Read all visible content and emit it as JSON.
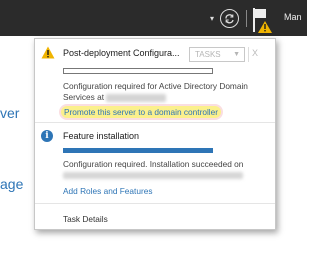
{
  "topbar": {
    "dropdown_glyph": "▾",
    "refresh_icon": "refresh-icon",
    "flag_icon": "flag-warning-icon",
    "manage_label": "Man"
  },
  "background": {
    "text1": "ver",
    "text2": "age"
  },
  "notifications": {
    "post_deployment": {
      "icon": "warning-icon",
      "title": "Post-deployment Configura...",
      "tasks_label": "TASKS",
      "close_glyph": "X",
      "progress": 0,
      "message": "Configuration required for Active Directory Domain Services at",
      "link": "Promote this server to a domain controller"
    },
    "feature_installation": {
      "icon": "info-icon",
      "title": "Feature installation",
      "progress": 1,
      "message": "Configuration required. Installation succeeded on",
      "link": "Add Roles and Features"
    },
    "task_details": "Task Details"
  },
  "colors": {
    "accent": "#2e75b6",
    "warning": "#f0b400",
    "highlight": "#fbf08c",
    "topbar": "#2b2b2b"
  }
}
